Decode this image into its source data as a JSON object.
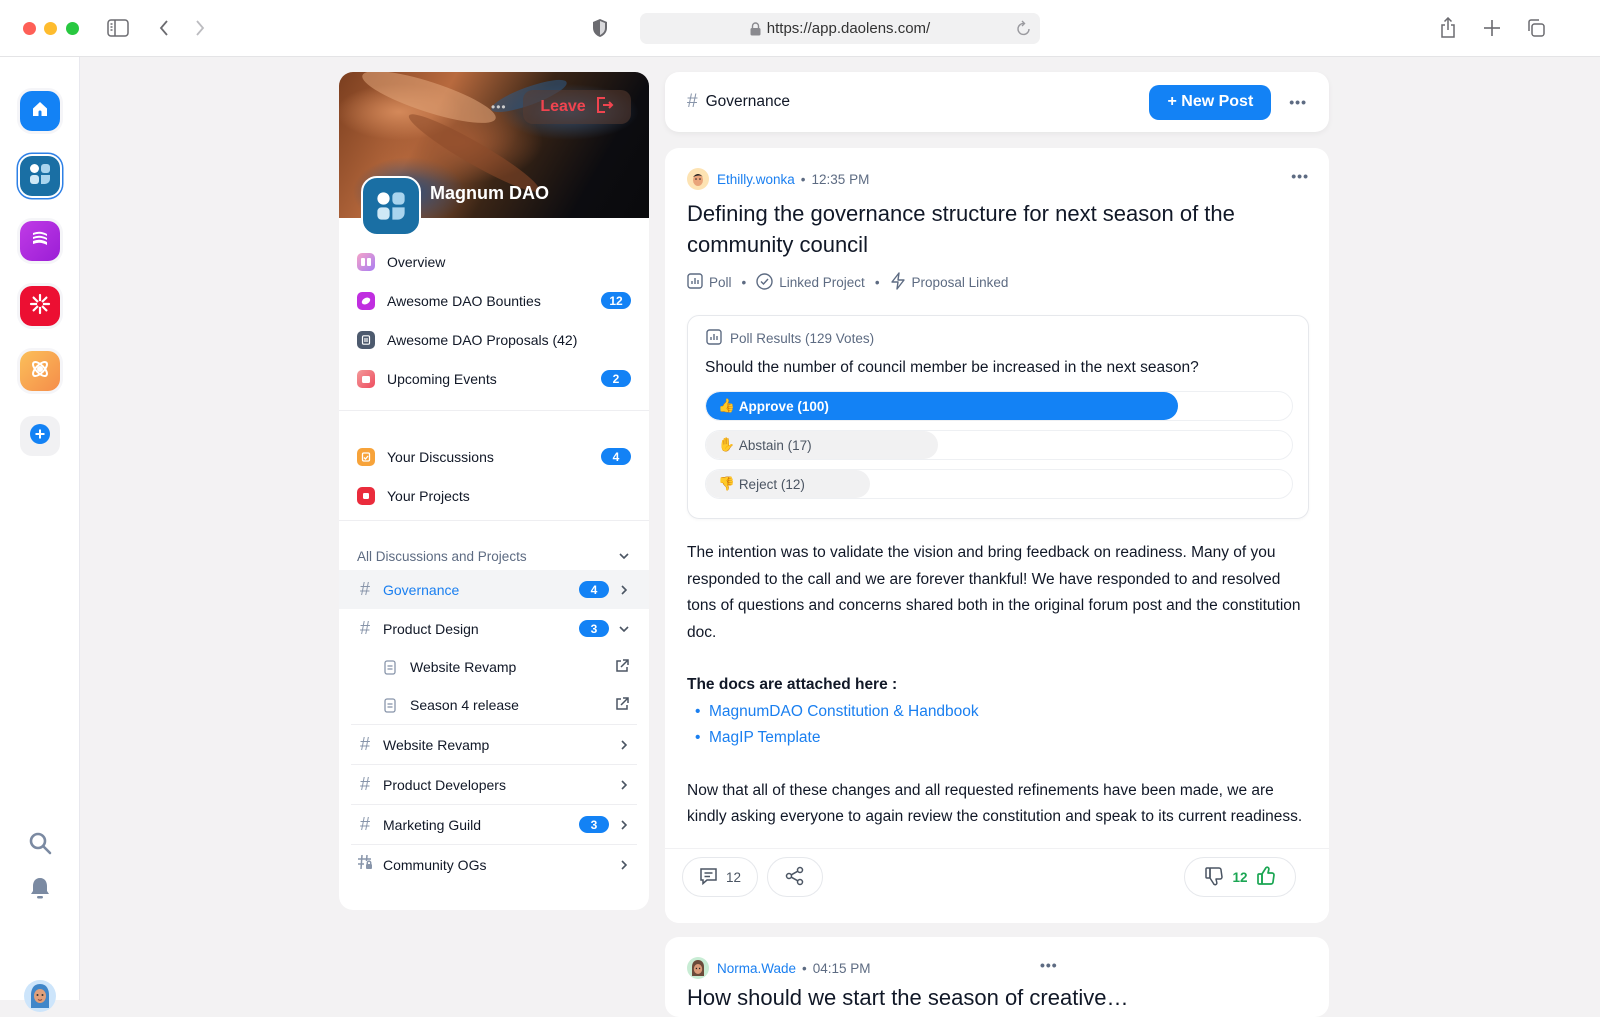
{
  "browser": {
    "url": "https://app.daolens.com/"
  },
  "rail": {
    "apps": [
      {
        "name": "home",
        "color": "#1382f5"
      },
      {
        "name": "magnum-dao",
        "color": "#1a6fa4",
        "active": true
      },
      {
        "name": "purple-dao",
        "color": "#b82fe0"
      },
      {
        "name": "red-dao",
        "color": "#ec0f32"
      },
      {
        "name": "orange-dao",
        "color": "#f9a54a"
      }
    ]
  },
  "community": {
    "name": "Magnum DAO",
    "leave_label": "Leave",
    "menu": [
      {
        "label": "Overview",
        "badge": null,
        "color": "#c58cf0"
      },
      {
        "label": "Awesome DAO Bounties",
        "badge": "12",
        "color": "#c02ee0"
      },
      {
        "label": "Awesome DAO Proposals (42)",
        "badge": null,
        "color": "#4d5a6e"
      },
      {
        "label": "Upcoming Events",
        "badge": "2",
        "color": "#f06b6b"
      }
    ],
    "personal": [
      {
        "label": "Your Discussions",
        "badge": "4",
        "color": "#f7a33a"
      },
      {
        "label": "Your Projects",
        "badge": null,
        "color": "#ea2c3c"
      }
    ],
    "section_title": "All Discussions and Projects",
    "channels": [
      {
        "label": "Governance",
        "badge": "4",
        "active": true
      },
      {
        "label": "Product Design",
        "badge": "3",
        "expanded": true,
        "subitems": [
          {
            "label": "Website Revamp"
          },
          {
            "label": "Season 4 release"
          }
        ]
      },
      {
        "label": "Website Revamp",
        "badge": null
      },
      {
        "label": "Product Developers",
        "badge": null
      },
      {
        "label": "Marketing Guild",
        "badge": "3"
      },
      {
        "label": "Community OGs",
        "badge": null,
        "locked": true
      }
    ]
  },
  "feed": {
    "channel_title": "Governance",
    "new_post_label": "+ New Post",
    "posts": [
      {
        "author": "Ethilly.wonka",
        "time": "12:35 PM",
        "title": "Defining the governance structure for next season of the community council",
        "tags": [
          "Poll",
          "Linked Project",
          "Proposal Linked"
        ],
        "poll": {
          "header": "Poll Results (129 Votes)",
          "question": "Should the number of council member be increased in the next season?",
          "total": 129,
          "options": [
            {
              "emoji": "👍",
              "label": "Approve (100)",
              "votes": 100
            },
            {
              "emoji": "✋",
              "label": "Abstain (17)",
              "votes": 17
            },
            {
              "emoji": "👎",
              "label": "Reject (12)",
              "votes": 12
            }
          ]
        },
        "body": {
          "p1": "The intention was to validate the vision and bring feedback on readiness. Many of you responded to the call and we are forever thankful! We have responded to and resolved tons of questions and concerns shared both in the original forum post and the constitution doc.",
          "docs_heading": "The docs are attached here :",
          "links": [
            "MagnumDAO Constitution & Handbook",
            "MagIP Template"
          ],
          "p2": "Now that all of these changes and all requested refinements have been made, we are kindly asking everyone to again review the constitution and speak to its current readiness."
        },
        "comments": "12",
        "upvotes": "12"
      },
      {
        "author": "Norma.Wade",
        "time": "04:15 PM",
        "title": "How should we start the season of creative…"
      }
    ]
  }
}
